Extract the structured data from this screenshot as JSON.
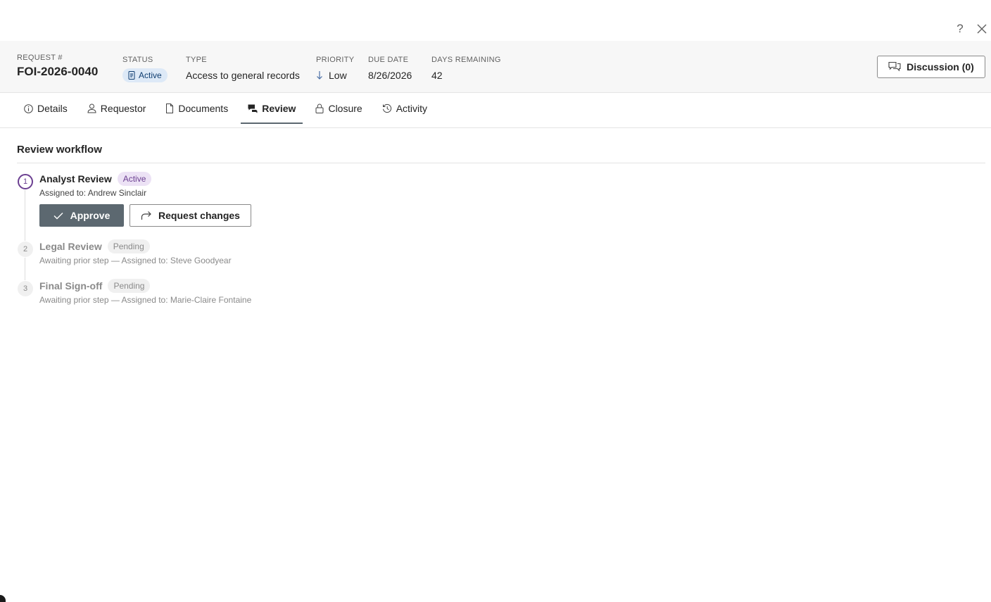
{
  "dialog": {
    "help_label": "?",
    "close_icon": "close-icon"
  },
  "header": {
    "request": {
      "label": "REQUEST #",
      "value": "FOI-2026-0040"
    },
    "status": {
      "label": "STATUS",
      "value": "Active",
      "icon": "document-icon"
    },
    "type": {
      "label": "TYPE",
      "value": "Access to general records"
    },
    "priority": {
      "label": "PRIORITY",
      "value": "Low",
      "icon": "arrow-down-icon"
    },
    "due_date": {
      "label": "DUE DATE",
      "value": "8/26/2026"
    },
    "days_remaining": {
      "label": "DAYS REMAINING",
      "value": "42"
    },
    "discussion_button": {
      "label": "Discussion (0)",
      "icon": "chat-icon"
    }
  },
  "tabs": [
    {
      "label": "Details",
      "icon": "info-icon",
      "active": false
    },
    {
      "label": "Requestor",
      "icon": "person-icon",
      "active": false
    },
    {
      "label": "Documents",
      "icon": "document-icon",
      "active": false
    },
    {
      "label": "Review",
      "icon": "review-icon",
      "active": true
    },
    {
      "label": "Closure",
      "icon": "lock-icon",
      "active": false
    },
    {
      "label": "Activity",
      "icon": "history-icon",
      "active": false
    }
  ],
  "review": {
    "title": "Review workflow",
    "steps": [
      {
        "number": "1",
        "name": "Analyst Review",
        "status": "Active",
        "subtitle": "Assigned to: Andrew Sinclair"
      },
      {
        "number": "2",
        "name": "Legal Review",
        "status": "Pending",
        "subtitle": "Awaiting prior step — Assigned to: Steve Goodyear"
      },
      {
        "number": "3",
        "name": "Final Sign-off",
        "status": "Pending",
        "subtitle": "Awaiting prior step — Assigned to: Marie-Claire Fontaine"
      }
    ],
    "actions": {
      "approve_label": "Approve",
      "request_changes_label": "Request changes"
    }
  },
  "colors": {
    "accent_purple": "#6b3f91",
    "primary_button": "#5c6870",
    "status_blue_bg": "#dde9f7",
    "status_blue_text": "#0f3d70"
  }
}
